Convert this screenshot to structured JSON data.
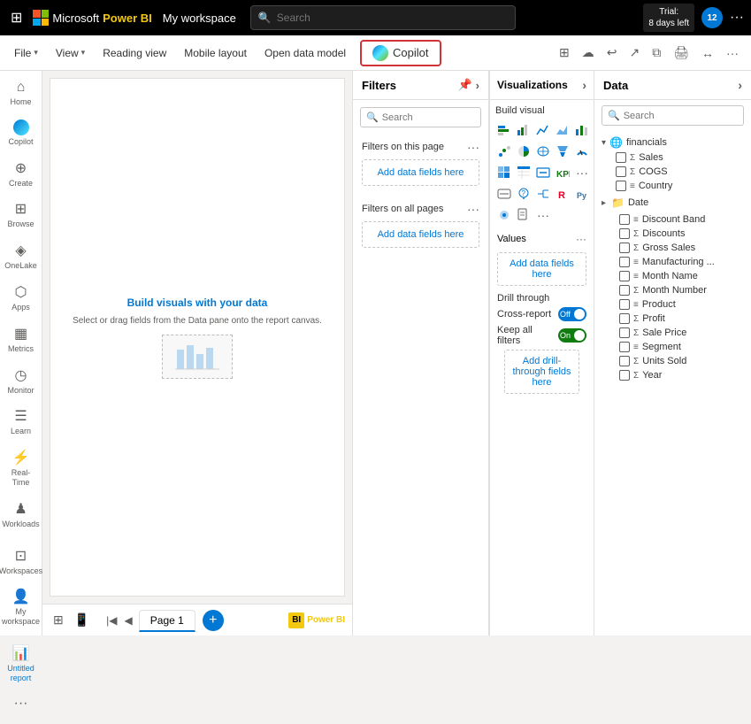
{
  "topbar": {
    "waffle": "⊞",
    "microsoft": "Microsoft",
    "powerbi": "Power BI",
    "workspace": "My workspace",
    "search_placeholder": "Search",
    "trial": "Trial:\n8 days left",
    "avatar": "12",
    "dots": "···"
  },
  "ribbon": {
    "file": "File",
    "view": "View",
    "reading_view": "Reading view",
    "mobile_layout": "Mobile layout",
    "open_data_model": "Open data model",
    "copilot": "Copilot",
    "icons": [
      "⊞",
      "☁",
      "↩",
      "↗",
      "↔",
      "🖨",
      "⧉",
      "···"
    ]
  },
  "sidebar": {
    "items": [
      {
        "id": "home",
        "label": "Home",
        "icon": "⌂"
      },
      {
        "id": "copilot",
        "label": "Copilot",
        "icon": "◎"
      },
      {
        "id": "create",
        "label": "Create",
        "icon": "+"
      },
      {
        "id": "browse",
        "label": "Browse",
        "icon": "⊞"
      },
      {
        "id": "onelake",
        "label": "OneLake",
        "icon": "◈"
      },
      {
        "id": "apps",
        "label": "Apps",
        "icon": "⬡"
      },
      {
        "id": "metrics",
        "label": "Metrics",
        "icon": "▦"
      },
      {
        "id": "monitor",
        "label": "Monitor",
        "icon": "◷"
      },
      {
        "id": "learn",
        "label": "Learn",
        "icon": "☰"
      },
      {
        "id": "realtime",
        "label": "Real-Time",
        "icon": "⚡"
      },
      {
        "id": "workloads",
        "label": "Workloads",
        "icon": "♟"
      },
      {
        "id": "workspaces",
        "label": "Workspaces",
        "icon": "⊡"
      },
      {
        "id": "myworkspace",
        "label": "My workspace",
        "icon": "👤"
      },
      {
        "id": "untitled",
        "label": "Untitled report",
        "icon": "📊",
        "active": true
      }
    ],
    "more_dots": "···"
  },
  "canvas": {
    "placeholder_title": "Build visuals with your data",
    "placeholder_subtitle": "Select or drag fields from the Data pane onto the report canvas."
  },
  "filters": {
    "title": "Filters",
    "search_placeholder": "Search",
    "on_this_page": "Filters on this page",
    "on_all_pages": "Filters on all pages",
    "add_data_fields": "Add data fields here",
    "add_data_fields2": "Add data fields here"
  },
  "visualizations": {
    "title": "Visualizations",
    "expand": "›",
    "build_visual": "Build visual",
    "values_label": "Values",
    "values_add": "Add data fields here",
    "drill_through": "Drill through",
    "cross_report": "Cross-report",
    "cross_report_toggle": "Off",
    "keep_all_filters": "Keep all filters",
    "keep_toggle": "On",
    "add_drill": "Add drill-through fields here",
    "icons": [
      "📊",
      "📈",
      "📉",
      "📋",
      "⬜",
      "〰",
      "📶",
      "🔲",
      "⊞",
      "⊟",
      "◙",
      "◎",
      "🗺",
      "◔",
      "◑",
      "▪",
      "◯",
      "🎯",
      "▤",
      "⊕",
      "◈",
      "🏆",
      "📌",
      "📍",
      "🔣",
      "◻",
      "▶",
      "⧉",
      "…"
    ]
  },
  "data": {
    "title": "Data",
    "expand": "›",
    "search_placeholder": "Search",
    "tree": {
      "financials": {
        "label": "financials",
        "expanded": true,
        "children": [
          {
            "label": "Sales",
            "type": "sigma",
            "checked": false
          },
          {
            "label": "COGS",
            "type": "sigma",
            "checked": false
          },
          {
            "label": "Country",
            "type": "field",
            "checked": false
          }
        ]
      },
      "date_group": {
        "label": "Date",
        "expanded": false,
        "children": [
          {
            "label": "Discount Band",
            "type": "field",
            "checked": false
          },
          {
            "label": "Discounts",
            "type": "sigma",
            "checked": false
          },
          {
            "label": "Gross Sales",
            "type": "sigma",
            "checked": false
          },
          {
            "label": "Manufacturing ...",
            "type": "field",
            "checked": false
          },
          {
            "label": "Month Name",
            "type": "field",
            "checked": false
          },
          {
            "label": "Month Number",
            "type": "sigma",
            "checked": false
          },
          {
            "label": "Product",
            "type": "field",
            "checked": false
          },
          {
            "label": "Profit",
            "type": "sigma",
            "checked": false
          },
          {
            "label": "Sale Price",
            "type": "sigma",
            "checked": false
          },
          {
            "label": "Segment",
            "type": "field",
            "checked": false
          },
          {
            "label": "Units Sold",
            "type": "sigma",
            "checked": false
          },
          {
            "label": "Year",
            "type": "sigma",
            "checked": false
          }
        ]
      }
    }
  },
  "page_bar": {
    "page1": "Page 1",
    "add_page": "+"
  }
}
